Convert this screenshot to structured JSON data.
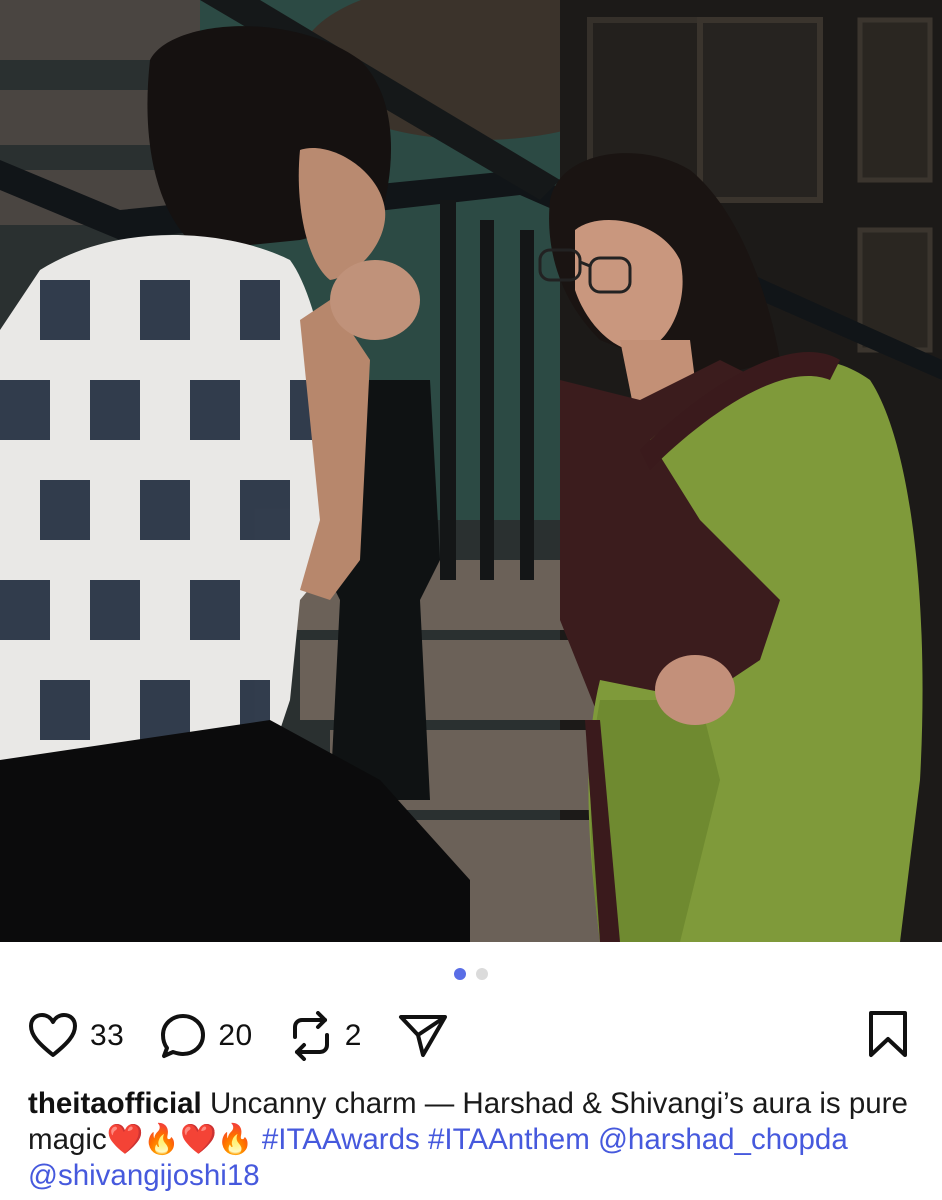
{
  "post": {
    "image_alt": "Harshad Chopda and Shivangi Joshi on a staircase set",
    "carousel": {
      "count": 2,
      "active_index": 0
    }
  },
  "actions": {
    "like": {
      "icon": "heart-outline-icon",
      "count": "33"
    },
    "comment": {
      "icon": "comment-bubble-icon",
      "count": "20"
    },
    "repost": {
      "icon": "repost-arrows-icon",
      "count": "2"
    },
    "share": {
      "icon": "send-paper-plane-icon"
    },
    "save": {
      "icon": "bookmark-outline-icon"
    }
  },
  "caption": {
    "username": "theitaofficial",
    "text": "Uncanny charm — Harshad & Shivangi’s aura is pure magic",
    "emoji": "❤️🔥❤️🔥",
    "hashtags": [
      "#ITAAwards",
      "#ITAAnthem"
    ],
    "mentions": [
      "@harshad_chopda",
      "@shivangijoshi18"
    ]
  },
  "colors": {
    "link": "#4659dd",
    "dot_active": "#5a6ee6",
    "dot_inactive": "#dbdbdb"
  }
}
